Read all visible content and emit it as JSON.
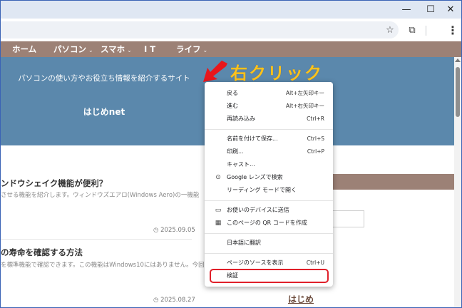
{
  "window": {
    "minimize_glyph": "—",
    "maximize_glyph": "☐",
    "close_glyph": "✕"
  },
  "toolbar": {
    "star_icon": "☆",
    "extensions_icon": "⧉",
    "menu_icon": "⋮"
  },
  "nav": {
    "items": [
      {
        "label": "ホーム",
        "chevron": ""
      },
      {
        "label": "パソコン",
        "chevron": "⌄"
      },
      {
        "label": "スマホ",
        "chevron": "⌄"
      },
      {
        "label": "I T",
        "chevron": ""
      },
      {
        "label": "ライフ",
        "chevron": "⌄"
      }
    ]
  },
  "hero": {
    "tagline": "パソコンの使い方やお役立ち情報を紹介するサイト",
    "site_title": "はじめnet"
  },
  "posts": [
    {
      "title": "ンドウシェイク機能が便利？",
      "excerpt": "させる機能を紹介します。ウィンドウズエアロ(Windows Aero)の一機能",
      "date": "2025.09.05"
    },
    {
      "title": "の寿命を確認する方法",
      "excerpt": "を標準機能で確認できます。この機能はWindows10にはありません。今回",
      "date": "2025.08.27"
    }
  ],
  "clock_icon": "◷",
  "sidebar": {
    "link": "はじめ"
  },
  "annotation": {
    "text": "右クリック",
    "color": "#ffc21a",
    "arrow_color": "#e8161b"
  },
  "context_menu": {
    "items": [
      {
        "label": "戻る",
        "shortcut": "Alt+左矢印キー",
        "icon": ""
      },
      {
        "label": "進む",
        "shortcut": "Alt+右矢印キー",
        "icon": ""
      },
      {
        "label": "再読み込み",
        "shortcut": "Ctrl+R",
        "icon": ""
      },
      {
        "label": "名前を付けて保存...",
        "shortcut": "Ctrl+S",
        "icon": ""
      },
      {
        "label": "印刷...",
        "shortcut": "Ctrl+P",
        "icon": ""
      },
      {
        "label": "キャスト...",
        "shortcut": "",
        "icon": ""
      },
      {
        "label": "Google レンズで検索",
        "shortcut": "",
        "icon": "⊙"
      },
      {
        "label": "リーディング モードで開く",
        "shortcut": "",
        "icon": ""
      },
      {
        "label": "お使いのデバイスに送信",
        "shortcut": "",
        "icon": "▭"
      },
      {
        "label": "このページの QR コードを作成",
        "shortcut": "",
        "icon": "▦"
      },
      {
        "label": "日本語に翻訳",
        "shortcut": "",
        "icon": ""
      },
      {
        "label": "ページのソースを表示",
        "shortcut": "Ctrl+U",
        "icon": ""
      },
      {
        "label": "検証",
        "shortcut": "",
        "icon": ""
      }
    ],
    "highlight_color": "#e0202a"
  },
  "colors": {
    "nav_bg": "#9c8176",
    "hero_bg": "#5b88ac",
    "titlebar_bg": "#dfe7f3"
  }
}
